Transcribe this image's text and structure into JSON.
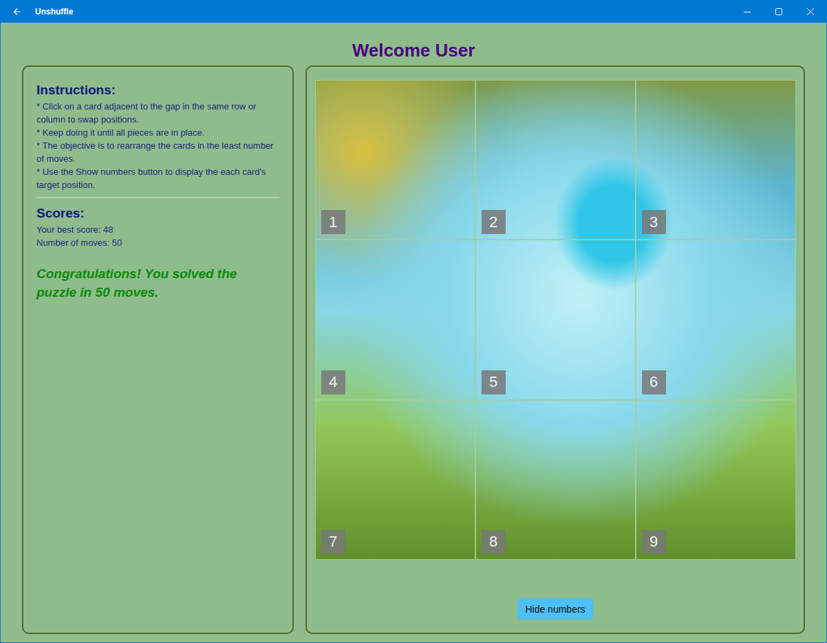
{
  "window": {
    "title": "Unshuffle"
  },
  "heading": "Welcome User",
  "instructions": {
    "title": "Instructions:",
    "items": [
      "* Click on a card adjacent to the gap in the same row or column to swap positions.",
      "* Keep doing it until all pieces are in place.",
      "* The objective is to rearrange the cards in the least number of moves.",
      "* Use the Show numbers button to display the each card's target position."
    ]
  },
  "scores": {
    "title": "Scores:",
    "best": "Your best score: 48",
    "moves": "Number of moves: 50"
  },
  "message": "Congratulations! You solved the puzzle in 50 moves.",
  "puzzle": {
    "numbers_shown": true,
    "tiles": [
      {
        "number": "1"
      },
      {
        "number": "2"
      },
      {
        "number": "3"
      },
      {
        "number": "4"
      },
      {
        "number": "5"
      },
      {
        "number": "6"
      },
      {
        "number": "7"
      },
      {
        "number": "8"
      },
      {
        "number": "9"
      }
    ]
  },
  "button": "Hide numbers"
}
